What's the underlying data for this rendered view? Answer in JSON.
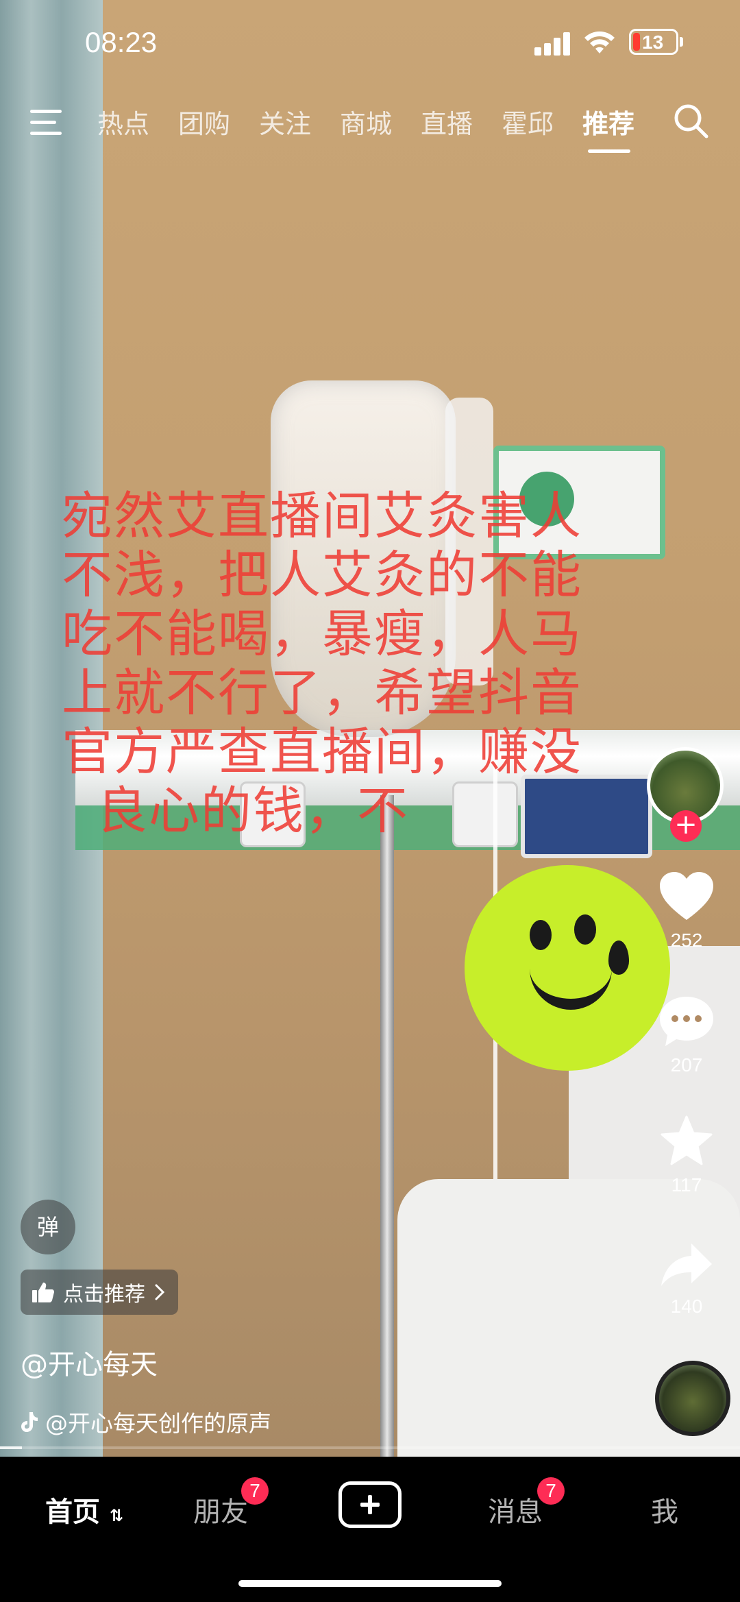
{
  "status_bar": {
    "time": "08:23",
    "battery": "13"
  },
  "top_nav": {
    "tabs": [
      "热点",
      "团购",
      "关注",
      "商城",
      "直播",
      "霍邱",
      "推荐"
    ],
    "active_tab": "推荐"
  },
  "video": {
    "overlay_text": "宛然艾直播间艾灸害人\n不浅，把人艾灸的不能\n吃不能喝，暴瘦，人马\n上就不行了，希望抖音\n官方严查直播间，赚没\n  良心的钱，不"
  },
  "side_actions": {
    "likes": "252",
    "comments": "207",
    "favorites": "117",
    "shares": "140"
  },
  "danmaku_label": "弹",
  "recommend_label": "点击推荐",
  "author": "@开心每天",
  "music": "@开心每天创作的原声",
  "progress": 0.03,
  "bottom_nav": {
    "home": "首页",
    "friends": "朋友",
    "friends_badge": "7",
    "messages": "消息",
    "messages_badge": "7",
    "me": "我"
  }
}
